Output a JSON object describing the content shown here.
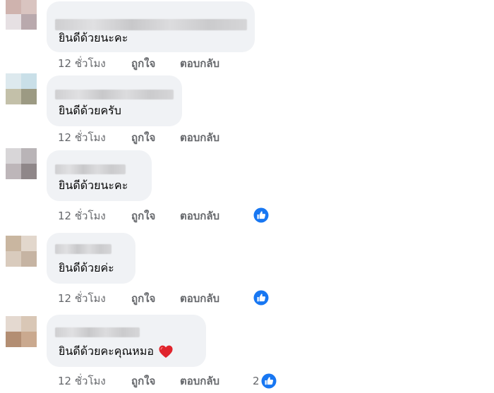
{
  "comments": [
    {
      "text": "ยินดีด้วยนะคะ",
      "time": "12 ชั่วโมง",
      "like_label": "ถูกใจ",
      "reply_label": "ตอบกลับ",
      "reaction_count": ""
    },
    {
      "text": "ยินดีด้วยครับ",
      "time": "12 ชั่วโมง",
      "like_label": "ถูกใจ",
      "reply_label": "ตอบกลับ",
      "reaction_count": ""
    },
    {
      "text": "ยินดีด้วยนะคะ",
      "time": "12 ชั่วโมง",
      "like_label": "ถูกใจ",
      "reply_label": "ตอบกลับ",
      "reaction_count": ""
    },
    {
      "text": "ยินดีด้วยค่ะ",
      "time": "12 ชั่วโมง",
      "like_label": "ถูกใจ",
      "reply_label": "ตอบกลับ",
      "reaction_count": ""
    },
    {
      "text": "ยินดีด้วยคะคุณหมอ",
      "time": "12 ชั่วโมง",
      "like_label": "ถูกใจ",
      "reply_label": "ตอบกลับ",
      "reaction_count": "2"
    }
  ],
  "icons": {
    "like_badge": "thumbs-up-icon",
    "heart_emoji": "red-heart-icon"
  },
  "colors": {
    "bubble_bg": "#f0f2f5",
    "meta_text": "#65676b",
    "like_blue": "#1877f2",
    "heart_red": "#e0242c"
  }
}
